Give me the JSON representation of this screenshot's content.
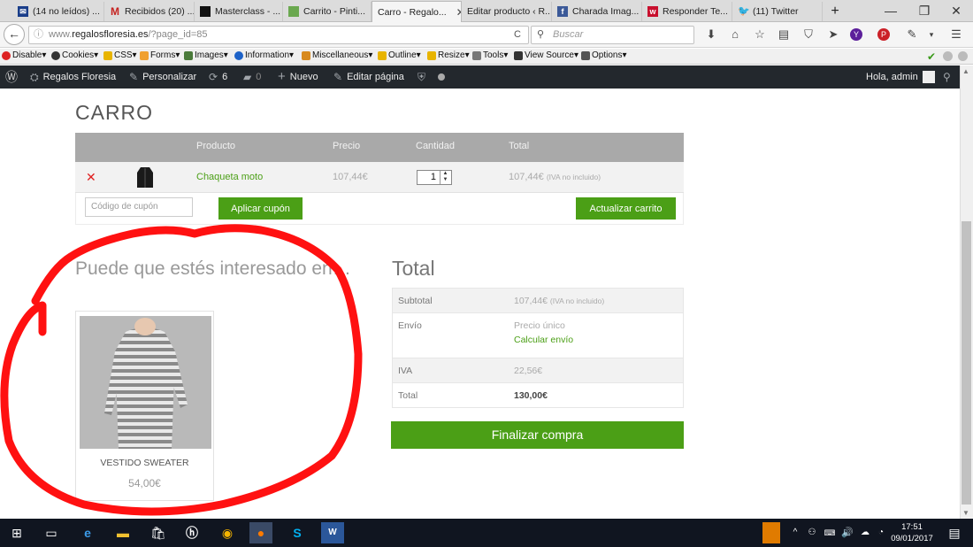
{
  "tabs": [
    {
      "label": "(14 no leídos) ...",
      "icon": "mail-icon",
      "color": "#1a3e8a"
    },
    {
      "label": "Recibidos (20) ...",
      "icon": "gmail-icon",
      "color": "#c5221f"
    },
    {
      "label": "Masterclass - ...",
      "icon": "masterclass-icon",
      "color": "#111111"
    },
    {
      "label": "Carrito - Pinti...",
      "icon": "pintiland-icon",
      "color": "#6aa84f"
    },
    {
      "label": "Carro - Regalo...",
      "icon": "regalos-icon",
      "color": "#ffffff",
      "active": true
    },
    {
      "label": "Editar producto ‹ R...",
      "icon": "wordpress-icon",
      "color": "#dddddd"
    },
    {
      "label": "Charada Imag...",
      "icon": "facebook-icon",
      "color": "#3b5998"
    },
    {
      "label": "Responder Te...",
      "icon": "wallapop-icon",
      "color": "#c8102e"
    },
    {
      "label": "(11) Twitter",
      "icon": "twitter-icon",
      "color": "#1da1f2"
    }
  ],
  "url": {
    "prefix": "www.",
    "domain": "regalosfloresia.es",
    "path": "/?page_id=85"
  },
  "search": {
    "placeholder": "Buscar"
  },
  "devtoolbar": [
    "Disable▾",
    "Cookies▾",
    "CSS▾",
    "Forms▾",
    "Images▾",
    "Information▾",
    "Miscellaneous▾",
    "Outline▾",
    "Resize▾",
    "Tools▾",
    "View Source▾",
    "Options▾"
  ],
  "adminbar": {
    "site": "Regalos Floresia",
    "customize": "Personalizar",
    "updates": "6",
    "comments": "0",
    "new": "Nuevo",
    "edit": "Editar página",
    "greeting": "Hola, admin"
  },
  "page": {
    "title": "CARRO"
  },
  "cart": {
    "headers": {
      "product": "Producto",
      "price": "Precio",
      "qty": "Cantidad",
      "total": "Total"
    },
    "item": {
      "name": "Chaqueta moto",
      "price": "107,44€",
      "qty": "1",
      "total": "107,44€",
      "total_note": "(IVA no incluido)"
    },
    "coupon_placeholder": "Código de cupón",
    "apply_coupon": "Aplicar cupón",
    "update_cart": "Actualizar carrito"
  },
  "related": {
    "title": "Puede que estés interesado en…",
    "product_name": "VESTIDO SWEATER",
    "product_price": "54,00€"
  },
  "totals": {
    "title": "Total",
    "subtotal_label": "Subtotal",
    "subtotal_value": "107,44€",
    "subtotal_note": "(IVA no incluido)",
    "shipping_label": "Envío",
    "shipping_value": "Precio único",
    "shipping_link": "Calcular envío",
    "tax_label": "IVA",
    "tax_value": "22,56€",
    "total_label": "Total",
    "total_value": "130,00€",
    "checkout": "Finalizar compra"
  },
  "taskbar": {
    "time": "17:51",
    "date": "09/01/2017"
  },
  "colors": {
    "accent_green": "#4b9f16",
    "annotation_red": "#ff1111"
  }
}
